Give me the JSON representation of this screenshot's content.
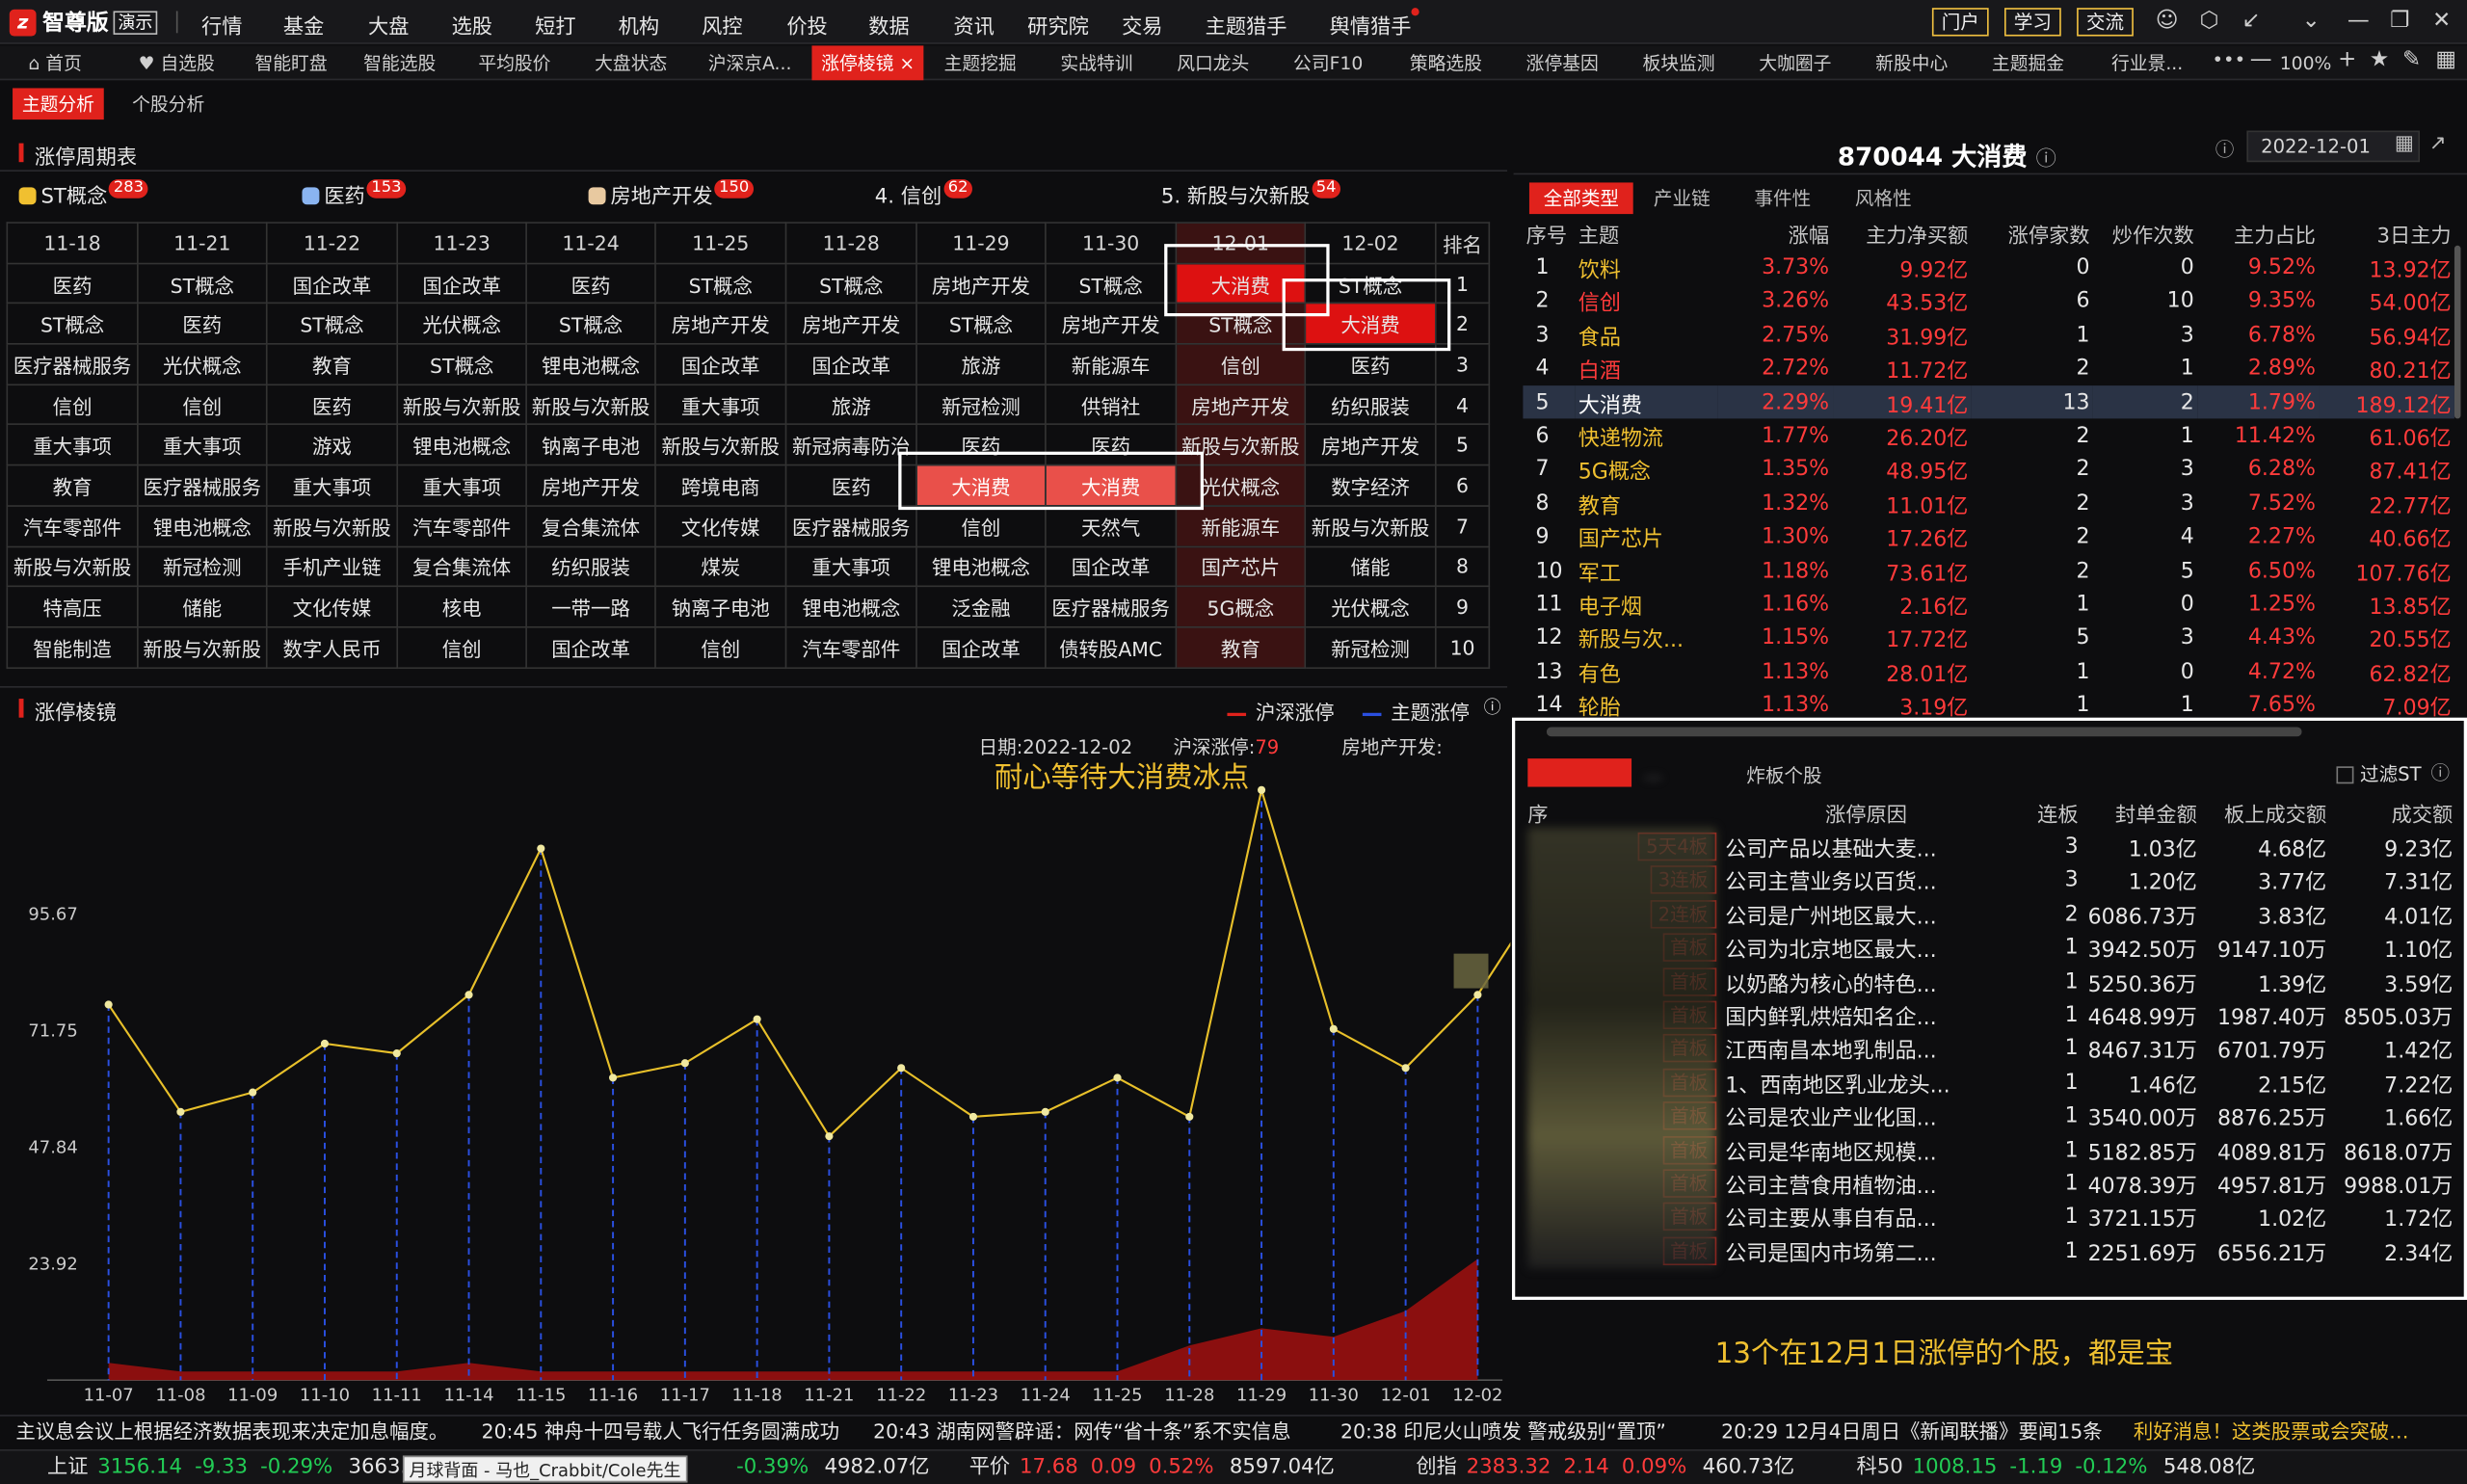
{
  "app": {
    "name": "智尊版",
    "mode": "演示"
  },
  "menu": [
    "行情",
    "基金",
    "大盘",
    "选股",
    "短打",
    "机构",
    "风控",
    "价投",
    "数据",
    "资讯",
    "研究院",
    "交易",
    "主题猎手",
    "舆情猎手"
  ],
  "header_buttons": [
    "门户",
    "学习",
    "交流"
  ],
  "tabs": [
    "首页",
    "自选股",
    "智能盯盘",
    "智能选股",
    "平均股价",
    "大盘状态",
    "沪深京A...",
    "涨停棱镜",
    "主题挖掘",
    "实战特训",
    "风口龙头",
    "公司F10",
    "策略选股",
    "涨停基因",
    "板块监测",
    "大咖圈子",
    "新股中心",
    "主题掘金",
    "行业景..."
  ],
  "active_tab": "涨停棱镜",
  "zoom": "100%",
  "subtabs": [
    "主题分析",
    "个股分析"
  ],
  "cycle_panel": {
    "title": "涨停周期表",
    "themes": [
      {
        "label": "ST概念",
        "count": "283"
      },
      {
        "label": "医药",
        "count": "153"
      },
      {
        "label": "房地产开发",
        "count": "150"
      },
      {
        "label": "4. 信创",
        "count": "62"
      },
      {
        "label": "5. 新股与次新股",
        "count": "54"
      }
    ],
    "dates": [
      "11-18",
      "11-21",
      "11-22",
      "11-23",
      "11-24",
      "11-25",
      "11-28",
      "11-29",
      "11-30",
      "12-01",
      "12-02"
    ],
    "rank_label": "排名",
    "rows": [
      [
        "医药",
        "ST概念",
        "国企改革",
        "国企改革",
        "医药",
        "ST概念",
        "ST概念",
        "房地产开发",
        "ST概念",
        "大消费",
        "ST概念",
        "1"
      ],
      [
        "ST概念",
        "医药",
        "ST概念",
        "光伏概念",
        "ST概念",
        "房地产开发",
        "房地产开发",
        "ST概念",
        "房地产开发",
        "ST概念",
        "大消费",
        "2"
      ],
      [
        "医疗器械服务",
        "光伏概念",
        "教育",
        "ST概念",
        "锂电池概念",
        "国企改革",
        "国企改革",
        "旅游",
        "新能源车",
        "信创",
        "医药",
        "3"
      ],
      [
        "信创",
        "信创",
        "医药",
        "新股与次新股",
        "新股与次新股",
        "重大事项",
        "旅游",
        "新冠检测",
        "供销社",
        "房地产开发",
        "纺织服装",
        "4"
      ],
      [
        "重大事项",
        "重大事项",
        "游戏",
        "锂电池概念",
        "钠离子电池",
        "新股与次新股",
        "新冠病毒防治",
        "医药",
        "医药",
        "新股与次新股",
        "房地产开发",
        "5"
      ],
      [
        "教育",
        "医疗器械服务",
        "重大事项",
        "重大事项",
        "房地产开发",
        "跨境电商",
        "医药",
        "大消费",
        "大消费",
        "光伏概念",
        "数字经济",
        "6"
      ],
      [
        "汽车零部件",
        "锂电池概念",
        "新股与次新股",
        "汽车零部件",
        "复合集流体",
        "文化传媒",
        "医疗器械服务",
        "信创",
        "天然气",
        "新能源车",
        "新股与次新股",
        "7"
      ],
      [
        "新股与次新股",
        "新冠检测",
        "手机产业链",
        "复合集流体",
        "纺织服装",
        "煤炭",
        "重大事项",
        "锂电池概念",
        "国企改革",
        "国产芯片",
        "储能",
        "8"
      ],
      [
        "特高压",
        "储能",
        "文化传媒",
        "核电",
        "一带一路",
        "钠离子电池",
        "锂电池概念",
        "泛金融",
        "医疗器械服务",
        "5G概念",
        "光伏概念",
        "9"
      ],
      [
        "智能制造",
        "新股与次新股",
        "数字人民币",
        "信创",
        "国企改革",
        "信创",
        "汽车零部件",
        "国企改革",
        "债转股AMC",
        "教育",
        "新冠检测",
        "10"
      ]
    ]
  },
  "prism_panel": {
    "title": "涨停棱镜",
    "legend": [
      "沪深涨停",
      "主题涨停"
    ],
    "tooltip": {
      "date_label": "日期:",
      "date": "2022-12-02",
      "hs_label": "沪深涨停:",
      "hs_value": "79",
      "theme_label": "房地产开发:"
    },
    "annotation": "耐心等待大消费冰点"
  },
  "chart_data": {
    "type": "line",
    "x": [
      "11-07",
      "11-08",
      "11-09",
      "11-10",
      "11-11",
      "11-14",
      "11-15",
      "11-16",
      "11-17",
      "11-18",
      "11-21",
      "11-22",
      "11-23",
      "11-24",
      "11-25",
      "11-28",
      "11-29",
      "11-30",
      "12-01",
      "12-02"
    ],
    "yticks": [
      "95.67",
      "71.75",
      "47.84",
      "23.92"
    ],
    "ylim": [
      0,
      120
    ],
    "series": [
      {
        "name": "沪深涨停",
        "color": "#e8c02a",
        "values": [
          77,
          55,
          59,
          69,
          67,
          79,
          109,
          62,
          65,
          74,
          50,
          64,
          54,
          55,
          62,
          54,
          121,
          72,
          64,
          79
        ]
      },
      {
        "name": "主题涨停",
        "color": "#2a4fe0",
        "values": [
          2,
          1,
          1,
          1,
          1,
          2,
          1,
          1,
          1,
          1,
          1,
          1,
          1,
          1,
          1,
          4,
          6,
          5,
          8,
          14
        ]
      }
    ]
  },
  "stock_info": {
    "code": "870044",
    "name": "大消费",
    "date": "2022-12-01"
  },
  "theme_tabs": [
    "全部类型",
    "产业链",
    "事件性",
    "风格性"
  ],
  "theme_table": {
    "headers": [
      "序号",
      "主题",
      "涨幅",
      "主力净买额",
      "涨停家数",
      "炒作次数",
      "主力占比",
      "3日主力"
    ],
    "rows": [
      [
        "1",
        "饮料",
        "3.73%",
        "9.92亿",
        "0",
        "0",
        "9.52%",
        "13.92亿"
      ],
      [
        "2",
        "信创",
        "3.26%",
        "43.53亿",
        "6",
        "10",
        "9.35%",
        "54.00亿"
      ],
      [
        "3",
        "食品",
        "2.75%",
        "31.99亿",
        "1",
        "3",
        "6.78%",
        "56.94亿"
      ],
      [
        "4",
        "白酒",
        "2.72%",
        "11.72亿",
        "2",
        "1",
        "2.89%",
        "80.21亿"
      ],
      [
        "5",
        "大消费",
        "2.29%",
        "19.41亿",
        "13",
        "2",
        "1.79%",
        "189.12亿"
      ],
      [
        "6",
        "快递物流",
        "1.77%",
        "26.20亿",
        "2",
        "1",
        "11.42%",
        "61.06亿"
      ],
      [
        "7",
        "5G概念",
        "1.35%",
        "48.95亿",
        "2",
        "3",
        "6.28%",
        "87.41亿"
      ],
      [
        "8",
        "教育",
        "1.32%",
        "11.01亿",
        "2",
        "3",
        "7.52%",
        "22.77亿"
      ],
      [
        "9",
        "国产芯片",
        "1.30%",
        "17.26亿",
        "2",
        "4",
        "2.27%",
        "40.66亿"
      ],
      [
        "10",
        "军工",
        "1.18%",
        "73.61亿",
        "2",
        "5",
        "6.50%",
        "107.76亿"
      ],
      [
        "11",
        "电子烟",
        "1.16%",
        "2.16亿",
        "1",
        "0",
        "1.25%",
        "13.85亿"
      ],
      [
        "12",
        "新股与次...",
        "1.15%",
        "17.72亿",
        "5",
        "3",
        "4.43%",
        "20.55亿"
      ],
      [
        "13",
        "有色",
        "1.13%",
        "28.01亿",
        "1",
        "0",
        "4.72%",
        "62.82亿"
      ],
      [
        "14",
        "轮胎",
        "1.13%",
        "3.19亿",
        "1",
        "1",
        "7.65%",
        "7.09亿"
      ]
    ]
  },
  "stock_panel": {
    "tabs": [
      "...",
      "炸板个股"
    ],
    "filter_label": "过滤ST",
    "headers": [
      "序",
      "涨停原因",
      "连板",
      "封单金额",
      "板上成交额",
      "成交额"
    ],
    "rows": [
      [
        "5天4板",
        "公司产品以基础大麦...",
        "3",
        "1.03亿",
        "4.68亿",
        "9.23亿"
      ],
      [
        "3连板",
        "公司主营业务以百货...",
        "3",
        "1.20亿",
        "3.77亿",
        "7.31亿"
      ],
      [
        "2连板",
        "公司是广州地区最大...",
        "2",
        "6086.73万",
        "3.83亿",
        "4.01亿"
      ],
      [
        "首板",
        "公司为北京地区最大...",
        "1",
        "3942.50万",
        "9147.10万",
        "1.10亿"
      ],
      [
        "首板",
        "以奶酪为核心的特色...",
        "1",
        "5250.36万",
        "1.39亿",
        "3.59亿"
      ],
      [
        "首板",
        "国内鲜乳烘焙知名企...",
        "1",
        "4648.99万",
        "1987.40万",
        "8505.03万"
      ],
      [
        "首板",
        "江西南昌本地乳制品...",
        "1",
        "8467.31万",
        "6701.79万",
        "1.42亿"
      ],
      [
        "首板",
        "1、西南地区乳业龙头...",
        "1",
        "1.46亿",
        "2.15亿",
        "7.22亿"
      ],
      [
        "首板",
        "公司是农业产业化国...",
        "1",
        "3540.00万",
        "8876.25万",
        "1.66亿"
      ],
      [
        "首板",
        "公司是华南地区规模...",
        "1",
        "5182.85万",
        "4089.81万",
        "8618.07万"
      ],
      [
        "首板",
        "公司主营食用植物油...",
        "1",
        "4078.39万",
        "4957.81万",
        "9988.01万"
      ],
      [
        "首板",
        "公司主要从事自有品...",
        "1",
        "3721.15万",
        "1.02亿",
        "1.72亿"
      ],
      [
        "首板",
        "公司是国内市场第二...",
        "1",
        "2251.69万",
        "6556.21万",
        "2.34亿"
      ]
    ],
    "note": "13个在12月1日涨停的个股，都是宝"
  },
  "ticker": [
    "主议息会议上根据经济数据表现来决定加息幅度。",
    "20:45 神舟十四号载人飞行任务圆满成功",
    "20:43 湖南网警辟谣：网传“省十条”系不实信息",
    "20:38 印尼火山喷发 警戒级别“置顶”",
    "20:29 12月4日周日《新闻联播》要闻15条",
    "利好消息！这类股票或会突破…"
  ],
  "indices": [
    {
      "name": "上证",
      "value": "3156.14",
      "chg": "-9.33",
      "pct": "-0.29%",
      "amt": "3663.19亿"
    },
    {
      "name": "",
      "value": "",
      "chg": "",
      "pct": "-0.39%",
      "amt": "4982.07亿"
    },
    {
      "name": "平价",
      "value": "17.68",
      "chg": "0.09",
      "pct": "0.52%",
      "amt": "8597.04亿"
    },
    {
      "name": "创指",
      "value": "2383.32",
      "chg": "2.14",
      "pct": "0.09%",
      "amt": "460.73亿"
    },
    {
      "name": "科50",
      "value": "1008.15",
      "chg": "-1.19",
      "pct": "-0.12%",
      "amt": "548.08亿"
    }
  ],
  "music_tooltip": "月球背面 - 马也_Crabbit/Cole先生"
}
